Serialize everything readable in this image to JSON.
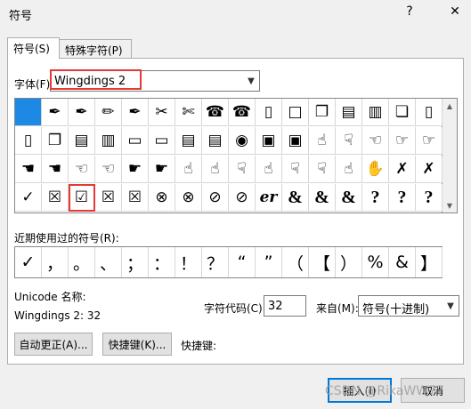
{
  "dialog": {
    "title": "符号",
    "help_glyph": "?",
    "close_glyph": "✕"
  },
  "tabs": [
    {
      "label": "符号(S)"
    },
    {
      "label": "特殊字符(P)"
    }
  ],
  "font": {
    "label": "字体(F):",
    "value": "Wingdings 2",
    "arrow": "⌵"
  },
  "grid": {
    "rows": [
      [
        "",
        "✒",
        "✒",
        "✏",
        "✒",
        "✂",
        "✄",
        "☎",
        "☎",
        "▯",
        "□",
        "❐",
        "▤",
        "▥",
        "❏",
        "▯"
      ],
      [
        "▯",
        "❐",
        "▤",
        "▥",
        "▭",
        "▭",
        "▤",
        "▤",
        "◉",
        "▣",
        "▣",
        "☝",
        "☟",
        "☜",
        "☞",
        "☞"
      ],
      [
        "☚",
        "☚",
        "☜",
        "☜",
        "☛",
        "☛",
        "☝",
        "☝",
        "☟",
        "☝",
        "☟",
        "☟",
        "☝",
        "✋",
        "✗",
        "✗"
      ],
      [
        "✓",
        "☒",
        "☑",
        "☒",
        "☒",
        "⊗",
        "⊗",
        "⊘",
        "⊘",
        "er",
        "&",
        "&",
        "&",
        "?",
        "?",
        "?"
      ]
    ],
    "selected_index": 0,
    "highlighted_index": 50
  },
  "recent": {
    "label": "近期使用过的符号(R):",
    "symbols": [
      "✓",
      "，",
      "。",
      "、",
      "；",
      "：",
      "！",
      "？",
      "“",
      "”",
      "（",
      "【",
      "）",
      "%",
      "&",
      "】"
    ]
  },
  "unicode": {
    "name_label": "Unicode 名称:",
    "name_value": "Wingdings 2: 32"
  },
  "charcode": {
    "label": "字符代码(C):",
    "value": "32",
    "from_label": "来自(M):",
    "from_value": "符号(十进制)"
  },
  "buttons": {
    "autocorrect": "自动更正(A)...",
    "shortcut_key": "快捷键(K)...",
    "shortcut_label": "快捷键:",
    "insert": "插入(I)",
    "cancel": "取消"
  },
  "watermark": "CSDN @RikaWW77",
  "colors": {
    "selected": "#1e88e5",
    "highlight": "#e53935",
    "primary_border": "#0078d7"
  }
}
